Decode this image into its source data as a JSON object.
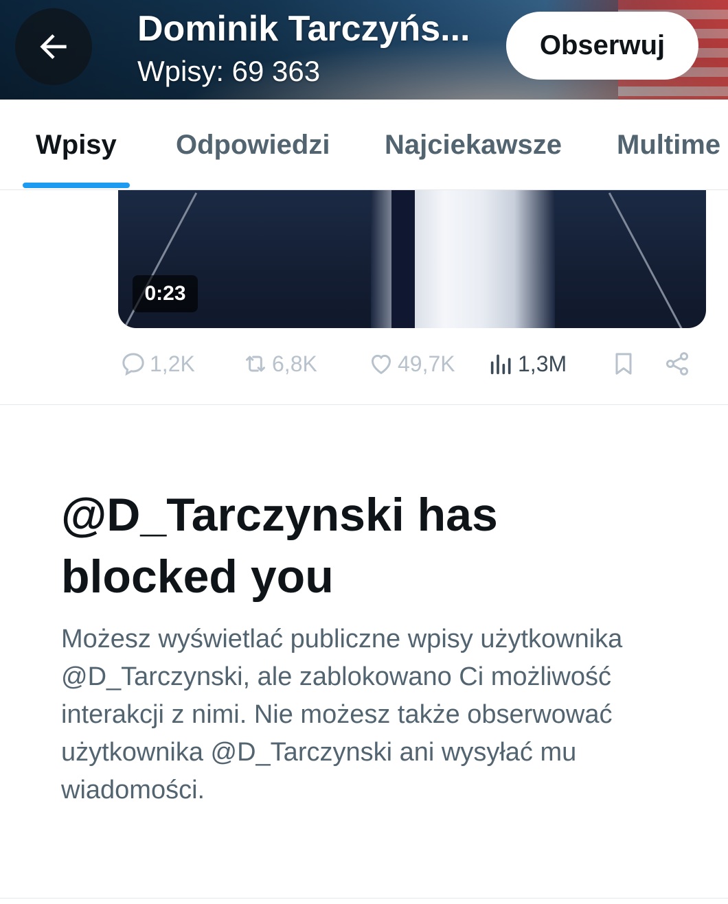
{
  "header": {
    "title": "Dominik Tarczyńs...",
    "posts_count": "Wpisy: 69 363",
    "follow_label": "Obserwuj",
    "back_icon": "arrow-left-icon"
  },
  "tabs": [
    {
      "label": "Wpisy",
      "active": true
    },
    {
      "label": "Odpowiedzi",
      "active": false
    },
    {
      "label": "Najciekawsze",
      "active": false
    },
    {
      "label": "Multime",
      "active": false
    }
  ],
  "video": {
    "duration": "0:23"
  },
  "actions": {
    "replies": "1,2K",
    "reposts": "6,8K",
    "likes": "49,7K",
    "views": "1,3M"
  },
  "blocked": {
    "title": "@D_Tarczynski has blocked you",
    "body": "Możesz wyświetlać publiczne wpisy użytkownika @D_Tarczynski, ale zablokowano Ci możliwość interakcji z nimi. Nie możesz także obserwować użytkownika @D_Tarczynski ani wysyłać mu wiadomości."
  },
  "colors": {
    "accent": "#1d9bf0",
    "text_primary": "#0f1419",
    "text_secondary": "#536471"
  }
}
